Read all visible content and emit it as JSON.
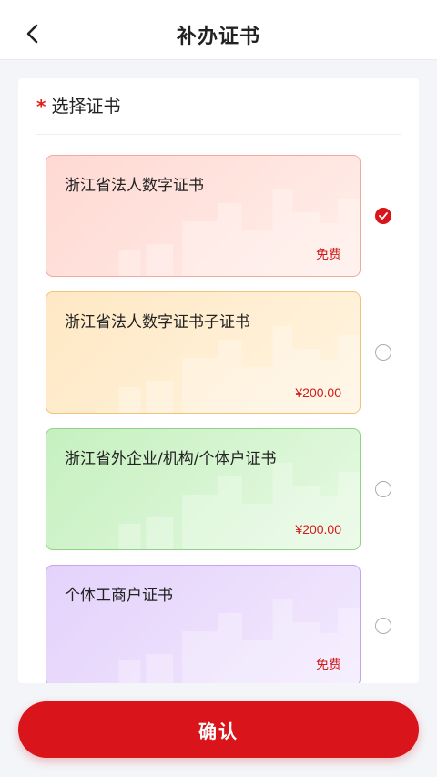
{
  "header": {
    "title": "补办证书"
  },
  "section": {
    "required_mark": "*",
    "title": "选择证书"
  },
  "certificates": [
    {
      "name": "浙江省法人数字证书",
      "price": "免费",
      "selected": true,
      "bg_from": "#ffd9d3",
      "bg_to": "#ffeee9",
      "border": "#f2a89b"
    },
    {
      "name": "浙江省法人数字证书子证书",
      "price": "¥200.00",
      "selected": false,
      "bg_from": "#ffe8c4",
      "bg_to": "#fff4e0",
      "border": "#f0c27a"
    },
    {
      "name": "浙江省外企业/机构/个体户证书",
      "price": "¥200.00",
      "selected": false,
      "bg_from": "#c6f0c0",
      "bg_to": "#e6f9e2",
      "border": "#8fd486"
    },
    {
      "name": "个体工商户证书",
      "price": "免费",
      "selected": false,
      "bg_from": "#e4d2fb",
      "bg_to": "#f2e9fe",
      "border": "#c4a6ef"
    }
  ],
  "footer": {
    "confirm_label": "确认"
  },
  "colors": {
    "accent": "#d9141b",
    "price": "#d01c1c"
  }
}
